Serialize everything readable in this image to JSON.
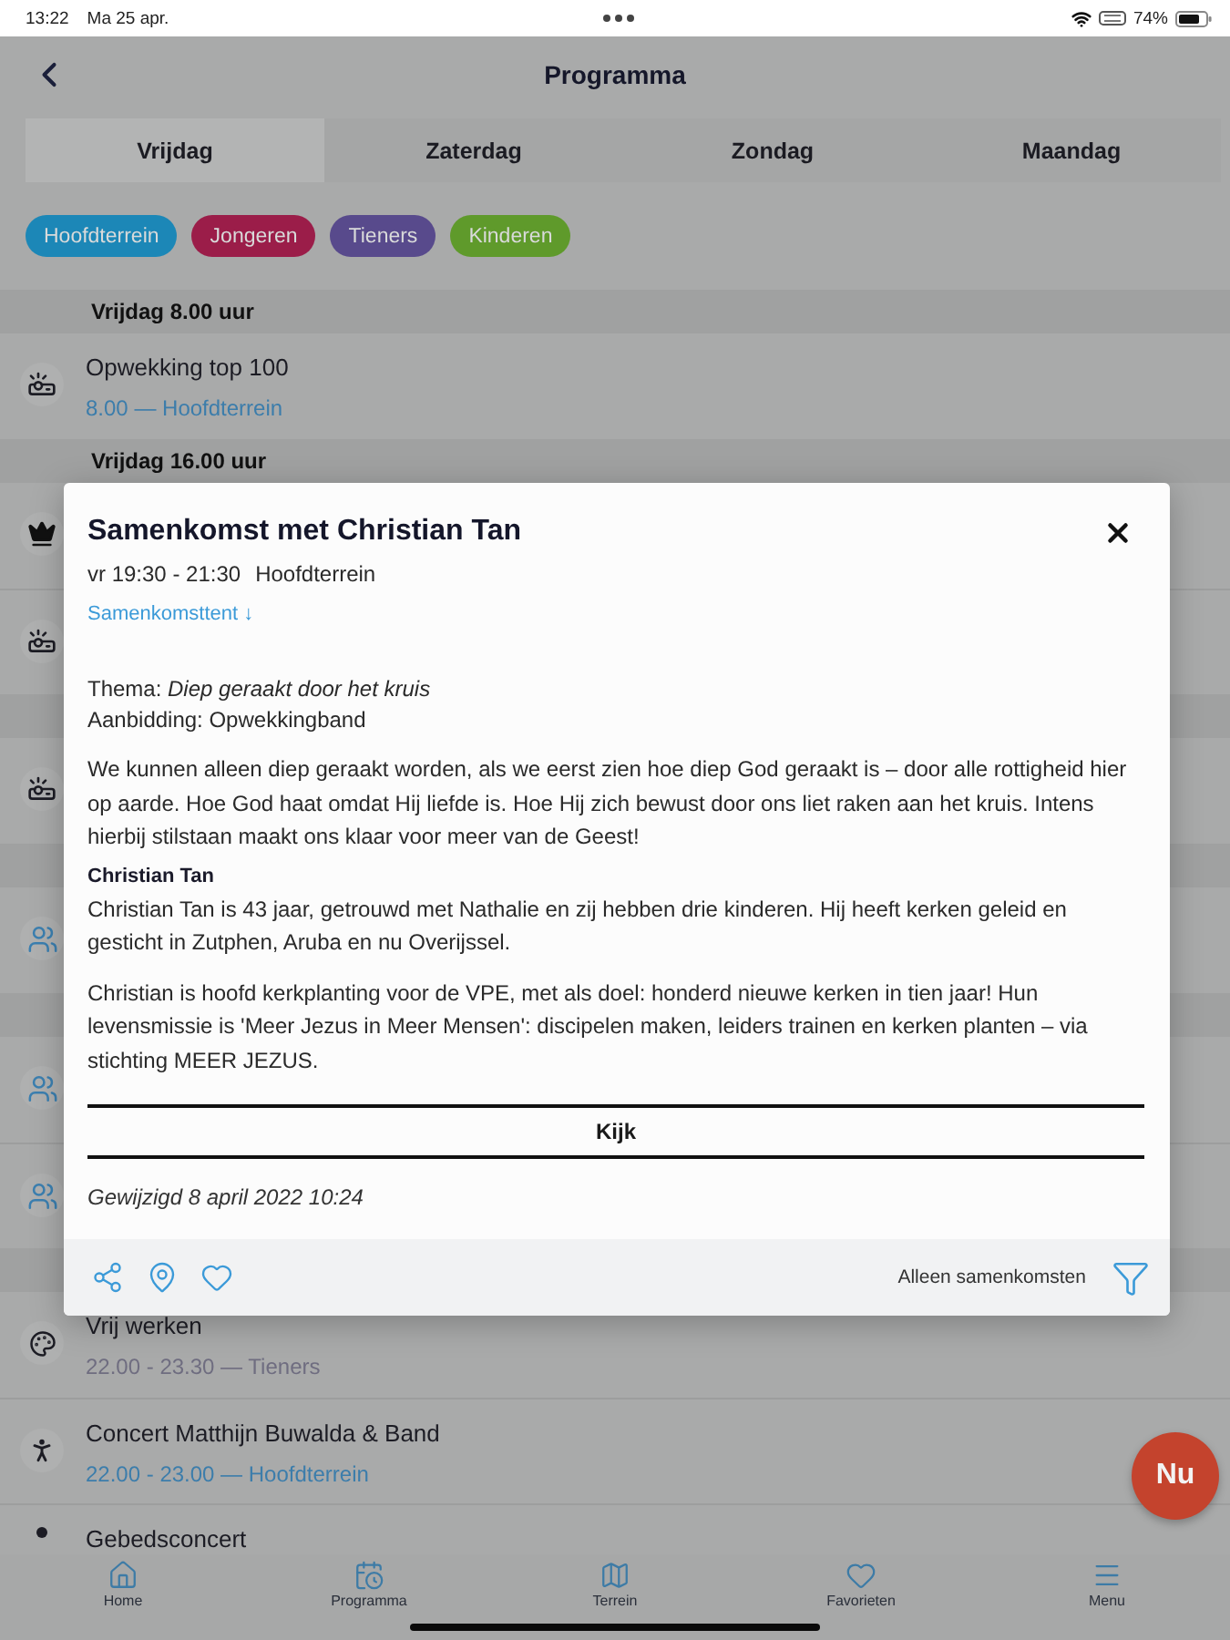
{
  "status_bar": {
    "time": "13:22",
    "date": "Ma 25 apr.",
    "battery": "74%"
  },
  "header": {
    "title": "Programma"
  },
  "tabs": [
    {
      "label": "Vrijdag",
      "selected": true
    },
    {
      "label": "Zaterdag",
      "selected": false
    },
    {
      "label": "Zondag",
      "selected": false
    },
    {
      "label": "Maandag",
      "selected": false
    }
  ],
  "filters": [
    {
      "label": "Hoofdterrein",
      "color": "#1c87b7"
    },
    {
      "label": "Jongeren",
      "color": "#9b1d49"
    },
    {
      "label": "Tieners",
      "color": "#584a8c"
    },
    {
      "label": "Kinderen",
      "color": "#5f9a2b"
    }
  ],
  "schedule": [
    {
      "kind": "header",
      "label": "Vrijdag 8.00 uur"
    },
    {
      "kind": "event",
      "title": "Opwekking top 100",
      "detail": "8.00 — Hoofdterrein",
      "color": "#3c7dab"
    },
    {
      "kind": "header",
      "label": "Vrijdag 16.00 uur"
    },
    {
      "kind": "event"
    },
    {
      "kind": "event"
    },
    {
      "kind": "header"
    },
    {
      "kind": "event"
    },
    {
      "kind": "header"
    },
    {
      "kind": "event"
    },
    {
      "kind": "header"
    },
    {
      "kind": "event"
    },
    {
      "kind": "event"
    },
    {
      "kind": "header"
    },
    {
      "kind": "event",
      "title": "Vrij werken",
      "detail": "22.00 - 23.30 — Tieners",
      "color": "#6f6d80"
    },
    {
      "kind": "event",
      "title": "Concert Matthijn Buwalda & Band",
      "detail": "22.00 - 23.00 — Hoofdterrein",
      "color": "#3c7dab"
    },
    {
      "kind": "event",
      "title": "Gebedsconcert"
    }
  ],
  "dialog": {
    "title": "Samenkomst met Christian Tan",
    "time": "vr 19:30 - 21:30",
    "location": "Hoofdterrein",
    "venue_link": "Samenkomsttent ↓",
    "theme": "Thema: *Diep geraakt door het kruis*",
    "worship": "Aanbidding: Opwekkingband",
    "intro": "We kunnen alleen diep geraakt worden, als we eerst zien hoe diep God geraakt is – door alle rottigheid hier op aarde. Hoe God haat omdat Hij liefde is. Hoe Hij zich bewust door ons liet raken aan het kruis. Intens hierbij stilstaan maakt ons klaar voor meer van de Geest!",
    "speaker": "Christian Tan",
    "bio": [
      "Christian Tan is 43 jaar, getrouwd met Nathalie en zij hebben drie kinderen. Hij heeft kerken geleid en gesticht in Zutphen, Aruba en nu Overijssel.",
      "Christian is hoofd kerkplanting voor de VPE, met als doel: honderd nieuwe kerken in tien jaar! Hun levensmissie is 'Meer Jezus in Meer Mensen': discipelen maken, leiders trainen en kerken planten – via stichting MEER JEZUS."
    ],
    "watch_button": "Kijk",
    "modified": "Gewijzigd 8 april 2022 10:24",
    "filter_label": "Alleen samenkomsten"
  },
  "now_button": "Nu",
  "tab_bar": [
    "Home",
    "Programma",
    "Terrein",
    "Favorieten",
    "Menu"
  ]
}
